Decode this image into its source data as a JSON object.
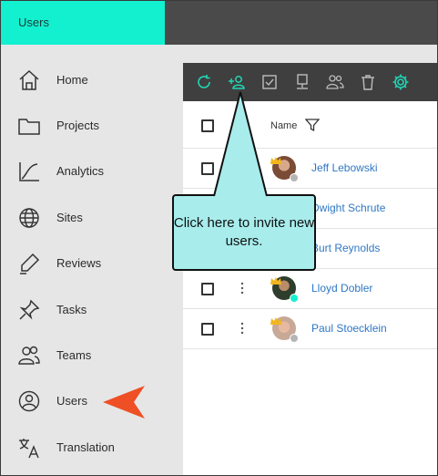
{
  "app": {
    "active_tab": "Users"
  },
  "sidebar": {
    "items": [
      {
        "label": "Home",
        "icon": "home-icon"
      },
      {
        "label": "Projects",
        "icon": "folder-icon"
      },
      {
        "label": "Analytics",
        "icon": "analytics-icon"
      },
      {
        "label": "Sites",
        "icon": "globe-icon"
      },
      {
        "label": "Reviews",
        "icon": "pen-icon"
      },
      {
        "label": "Tasks",
        "icon": "pin-icon"
      },
      {
        "label": "Teams",
        "icon": "team-icon"
      },
      {
        "label": "Users",
        "icon": "user-circle-icon"
      },
      {
        "label": "Translation",
        "icon": "translate-icon"
      }
    ]
  },
  "toolbar": {
    "buttons": [
      "refresh-icon",
      "add-user-icon",
      "checklist-icon",
      "monitor-icon",
      "teams-icon",
      "trash-icon",
      "gear-icon"
    ],
    "accent": "#21d6b5"
  },
  "table": {
    "header": {
      "name_label": "Name"
    },
    "rows": [
      {
        "name": "Jeff Lebowski",
        "status": "offline"
      },
      {
        "name": "Dwight Schrute",
        "status": "offline"
      },
      {
        "name": "Burt Reynolds",
        "status": "offline"
      },
      {
        "name": "Lloyd Dobler",
        "status": "online"
      },
      {
        "name": "Paul Stoecklein",
        "status": "offline"
      }
    ]
  },
  "callout": {
    "text": "Click here to invite new users."
  },
  "colors": {
    "accent": "#12f0cf",
    "link": "#2f78c4",
    "callout_fill": "#a8ecec",
    "pointer_arrow": "#ef4f24",
    "online": "#12f0cf",
    "offline": "#b5b5b5"
  }
}
